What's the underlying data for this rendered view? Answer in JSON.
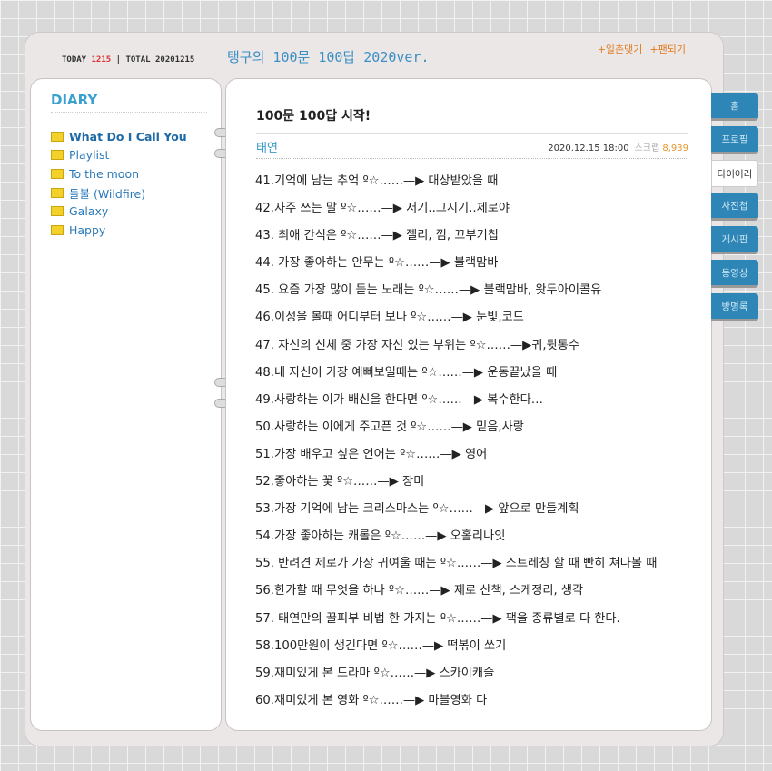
{
  "header": {
    "today_label": "TODAY",
    "today": "1215",
    "total_label": "| TOTAL",
    "total": "20201215",
    "title": "탱구의 100문 100답 2020ver.",
    "links": [
      "+일촌맺기",
      "+팬되기"
    ]
  },
  "sidebar": {
    "heading": "DIARY",
    "folders": [
      "What Do I Call You",
      "Playlist",
      "To the moon",
      "들불 (Wildfire)",
      "Galaxy",
      "Happy"
    ]
  },
  "post": {
    "title": "100문 100답 시작!",
    "author": "태연",
    "date": "2020.12.15 18:00",
    "scrap_label": "스크랩",
    "scrap_count": "8,939",
    "items": [
      "41.기억에 남는 추억 º☆……—▶ 대상받았을 때",
      "42.자주 쓰는 말 º☆……—▶ 저기..그시기..제로야",
      "43. 최애 간식은 º☆……—▶ 젤리, 껌, 꼬부기칩",
      "44. 가장 좋아하는 안무는 º☆……—▶ 블랙맘바",
      "45. 요즘 가장 많이 듣는 노래는 º☆……—▶ 블랙맘바, 왓두아이콜유",
      "46.이성을 볼때 어디부터 보나 º☆……—▶ 눈빛,코드",
      "47. 자신의 신체 중 가장 자신 있는 부위는 º☆……—▶귀,뒷통수",
      "48.내 자신이 가장 예뻐보일때는 º☆……—▶ 운동끝났을 때",
      "49.사랑하는 이가 배신을 한다면 º☆……—▶ 복수한다…",
      "50.사랑하는 이에게 주고픈 것 º☆……—▶ 믿음,사랑",
      "51.가장 배우고 싶은 언어는 º☆……—▶ 영어",
      "52.좋아하는 꽃 º☆……—▶ 장미",
      "53.가장 기억에 남는 크리스마스는 º☆……—▶ 앞으로 만들계획",
      "54.가장 좋아하는 캐롤은 º☆……—▶ 오홀리나잇",
      "55. 반려견 제로가 가장 귀여울 때는 º☆……—▶ 스트레칭 할 때 빤히 쳐다볼 때",
      "56.한가할 때 무엇을 하나 º☆……—▶ 제로 산책, 스케정리, 생각",
      "57. 태연만의 꿀피부 비법 한 가지는 º☆……—▶ 팩을 종류별로 다 한다.",
      "58.100만원이 생긴다면 º☆……—▶ 떡볶이 쏘기",
      "59.재미있게 본 드라마 º☆……—▶ 스카이캐슬",
      "60.재미있게 본 영화 º☆……—▶ 마블영화 다"
    ]
  },
  "tabs": [
    "홈",
    "프로필",
    "다이어리",
    "사진첩",
    "게시판",
    "동영상",
    "방명록"
  ]
}
